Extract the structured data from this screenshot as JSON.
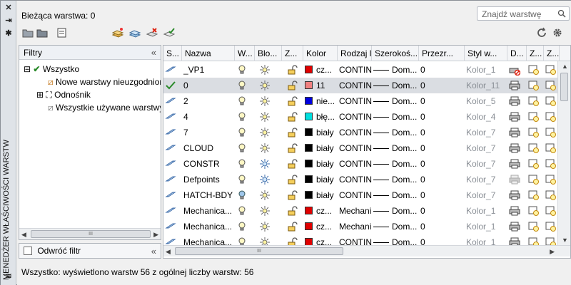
{
  "window": {
    "vertical_title": "MENEDŻER WŁAŚCIWOŚCI WARSTW",
    "current_layer": "Bieżąca warstwa: 0",
    "search_placeholder": "Znajdź warstwę"
  },
  "filters": {
    "header": "Filtry",
    "tree": [
      {
        "label": "Wszystko",
        "icon": "all-filter-icon",
        "expander": "⊟"
      },
      {
        "label": "Nowe warstwy nieuzgodnione",
        "icon": "new-layers-filter-icon",
        "expander": ""
      },
      {
        "label": "Odnośnik",
        "icon": "xref-icon",
        "expander": "⊞"
      },
      {
        "label": "Wszystkie używane warstwy",
        "icon": "used-layers-filter-icon",
        "expander": ""
      }
    ],
    "invert_label": "Odwróć filtr"
  },
  "columns": [
    "S...",
    "Nazwa",
    "W...",
    "Blo...",
    "Z...",
    "Kolor",
    "Rodzaj li...",
    "Szerokoś...",
    "Przezr...",
    "Styl w...",
    "D...",
    "Z...",
    "Z..."
  ],
  "layers": [
    {
      "status": "layer-icon",
      "name": "_VP1",
      "color_hex": "#e00000",
      "color_name": "cz...",
      "linetype": "CONTIN...",
      "lineweight": "Dom...",
      "transparency": "0",
      "plotstyle": "Kolor_1",
      "plot": "no-plot-icon",
      "freeze_blue": false,
      "selected": false
    },
    {
      "status": "current-check-icon",
      "name": "0",
      "color_hex": "#f08080",
      "color_name": "11",
      "linetype": "CONTIN...",
      "lineweight": "Dom...",
      "transparency": "0",
      "plotstyle": "Kolor_11",
      "plot": "printer-icon",
      "freeze_blue": false,
      "selected": true
    },
    {
      "status": "layer-icon",
      "name": "2",
      "color_hex": "#0000e0",
      "color_name": "nie...",
      "linetype": "CONTIN...",
      "lineweight": "Dom...",
      "transparency": "0",
      "plotstyle": "Kolor_5",
      "plot": "printer-icon",
      "freeze_blue": false,
      "selected": false
    },
    {
      "status": "layer-icon",
      "name": "4",
      "color_hex": "#00e0e0",
      "color_name": "błę...",
      "linetype": "CONTIN...",
      "lineweight": "Dom...",
      "transparency": "0",
      "plotstyle": "Kolor_4",
      "plot": "printer-icon",
      "freeze_blue": false,
      "selected": false
    },
    {
      "status": "layer-icon",
      "name": "7",
      "color_hex": "#000000",
      "color_name": "biały",
      "linetype": "CONTIN...",
      "lineweight": "Dom...",
      "transparency": "0",
      "plotstyle": "Kolor_7",
      "plot": "printer-icon",
      "freeze_blue": false,
      "selected": false
    },
    {
      "status": "layer-icon",
      "name": "CLOUD",
      "color_hex": "#000000",
      "color_name": "biały",
      "linetype": "CONTIN...",
      "lineweight": "Dom...",
      "transparency": "0",
      "plotstyle": "Kolor_7",
      "plot": "printer-icon",
      "freeze_blue": false,
      "selected": false
    },
    {
      "status": "layer-icon",
      "name": "CONSTR",
      "color_hex": "#000000",
      "color_name": "biały",
      "linetype": "CONTIN...",
      "lineweight": "Dom...",
      "transparency": "0",
      "plotstyle": "Kolor_7",
      "plot": "printer-icon",
      "freeze_blue": true,
      "selected": false
    },
    {
      "status": "layer-icon",
      "name": "Defpoints",
      "color_hex": "#000000",
      "color_name": "biały",
      "linetype": "CONTIN...",
      "lineweight": "Dom...",
      "transparency": "0",
      "plotstyle": "Kolor_7",
      "plot": "printer-grey-icon",
      "freeze_blue": true,
      "selected": false
    },
    {
      "status": "layer-icon",
      "name": "HATCH-BDY",
      "color_hex": "#000000",
      "color_name": "biały",
      "linetype": "CONTIN...",
      "lineweight": "Dom...",
      "transparency": "0",
      "plotstyle": "Kolor_7",
      "plot": "printer-icon",
      "freeze_blue": false,
      "selected": false
    },
    {
      "status": "layer-icon",
      "name": "Mechanica...",
      "color_hex": "#e00000",
      "color_name": "cz...",
      "linetype": "Mechani...",
      "lineweight": "Dom...",
      "transparency": "0",
      "plotstyle": "Kolor_1",
      "plot": "printer-icon",
      "freeze_blue": false,
      "selected": false
    },
    {
      "status": "layer-icon",
      "name": "Mechanica...",
      "color_hex": "#e00000",
      "color_name": "cz...",
      "linetype": "Mechani...",
      "lineweight": "Dom...",
      "transparency": "0",
      "plotstyle": "Kolor_1",
      "plot": "printer-icon",
      "freeze_blue": false,
      "selected": false
    },
    {
      "status": "layer-icon",
      "name": "Mechanica...",
      "color_hex": "#e00000",
      "color_name": "cz...",
      "linetype": "CONTIN...",
      "lineweight": "Dom...",
      "transparency": "0",
      "plotstyle": "Kolor_1",
      "plot": "printer-icon",
      "freeze_blue": false,
      "selected": false
    }
  ],
  "status_bar": "Wszystko: wyświetlono warstw 56 z ogólnej liczby warstw: 56"
}
